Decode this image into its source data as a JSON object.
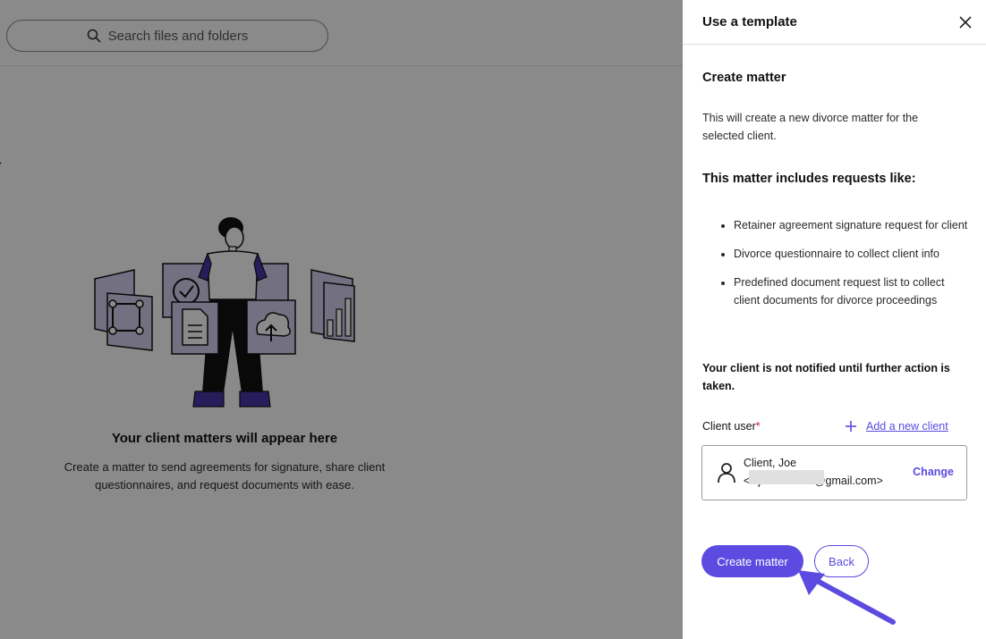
{
  "background": {
    "search": {
      "placeholder": "Search files and folders"
    },
    "empty_state": {
      "title": "Your client matters will appear here",
      "description": "Create a matter to send agreements for signature, share client questionnaires, and request documents with ease."
    }
  },
  "panel": {
    "title": "Use a template",
    "heading": "Create matter",
    "description": "This will create a new divorce matter for the selected client.",
    "includes_heading": "This matter includes requests like:",
    "requests": [
      "Retainer agreement signature request for client",
      "Divorce questionnaire to collect client info",
      "Predefined document request list to collect client documents for divorce proceedings"
    ],
    "notice": "Your client is not notified until further action is taken.",
    "client_user": {
      "label": "Client user",
      "required_mark": "*",
      "add_label": "Add a new client",
      "name": "Client, Joe",
      "email": "<wjwhool.com@gmail.com>",
      "change_label": "Change"
    },
    "buttons": {
      "create": "Create matter",
      "back": "Back"
    }
  },
  "colors": {
    "accent": "#5b4be0",
    "illustration_purple": "#3f2e9e",
    "illustration_lavender": "#c9c5ee"
  }
}
